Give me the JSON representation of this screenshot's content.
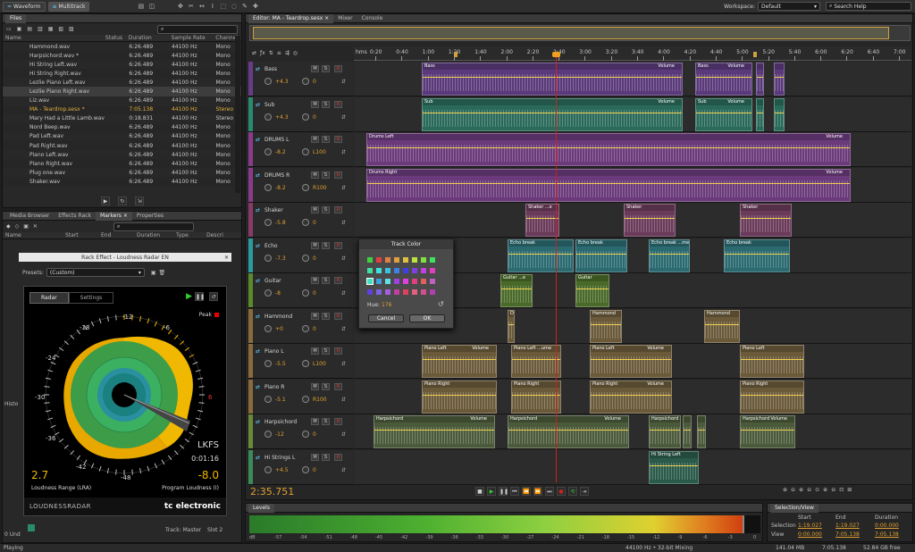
{
  "topbar": {
    "waveform": "Waveform",
    "multitrack": "Multitrack",
    "workspace_label": "Workspace:",
    "workspace_value": "Default",
    "search_placeholder": "Search Help"
  },
  "files": {
    "title": "Files",
    "columns": {
      "name": "Name",
      "status": "Status",
      "duration": "Duration",
      "sample_rate": "Sample Rate",
      "channels": "Channels"
    },
    "rows": [
      {
        "name": "Hammond.wav",
        "duration": "6:26.489",
        "sr": "44100 Hz",
        "ch": "Mono"
      },
      {
        "name": "Harpsichord.wav *",
        "duration": "6:26.489",
        "sr": "44100 Hz",
        "ch": "Mono"
      },
      {
        "name": "Hi String Left.wav",
        "duration": "6:26.489",
        "sr": "44100 Hz",
        "ch": "Mono"
      },
      {
        "name": "Hi String Right.wav",
        "duration": "6:26.489",
        "sr": "44100 Hz",
        "ch": "Mono"
      },
      {
        "name": "Lezlie Piano Left.wav",
        "duration": "6:26.489",
        "sr": "44100 Hz",
        "ch": "Mono"
      },
      {
        "name": "Lezlie Piano Right.wav",
        "duration": "6:26.489",
        "sr": "44100 Hz",
        "ch": "Mono"
      },
      {
        "name": "Liz.wav",
        "duration": "6:26.489",
        "sr": "44100 Hz",
        "ch": "Mono"
      },
      {
        "name": "MA - Teardrop.sesx *",
        "duration": "7:05.138",
        "sr": "44100 Hz",
        "ch": "Stereo"
      },
      {
        "name": "Mary Had a Little Lamb.wav",
        "duration": "0:18.831",
        "sr": "44100 Hz",
        "ch": "Stereo"
      },
      {
        "name": "Nord Beep.wav",
        "duration": "6:26.489",
        "sr": "44100 Hz",
        "ch": "Mono"
      },
      {
        "name": "Pad Left.wav",
        "duration": "6:26.489",
        "sr": "44100 Hz",
        "ch": "Mono"
      },
      {
        "name": "Pad Right.wav",
        "duration": "6:26.489",
        "sr": "44100 Hz",
        "ch": "Mono"
      },
      {
        "name": "Piano Left.wav",
        "duration": "6:26.489",
        "sr": "44100 Hz",
        "ch": "Mono"
      },
      {
        "name": "Piano Right.wav",
        "duration": "6:26.489",
        "sr": "44100 Hz",
        "ch": "Mono"
      },
      {
        "name": "Plug one.wav",
        "duration": "6:26.489",
        "sr": "44100 Hz",
        "ch": "Mono"
      },
      {
        "name": "Shaker.wav",
        "duration": "6:26.489",
        "sr": "44100 Hz",
        "ch": "Mono"
      }
    ]
  },
  "midpanel": {
    "tabs": [
      "Media Browser",
      "Effects Rack",
      "Markers ×",
      "Properties"
    ],
    "columns": [
      "Name",
      "Start",
      "End",
      "Duration",
      "Type",
      "Descri"
    ],
    "search_icon": "search-icon"
  },
  "rack": {
    "title": "Rack Effect - Loudness Radar EN",
    "presets_label": "Presets:",
    "presets_value": "(Custom)"
  },
  "radar": {
    "tab_radar": "Radar",
    "tab_settings": "Settings",
    "peak": "Peak",
    "ring_labels": [
      "-12",
      "-6",
      "-18",
      "-24",
      "-30",
      "-36",
      "-42",
      "-48",
      "6"
    ],
    "lkfs": "LKFS",
    "time": "0:01:16",
    "lra_value": "2.7",
    "lra_label": "Loudness Range (LRA)",
    "program_value": "-8.0",
    "program_label": "Program Loudness (I)",
    "brand_left": "LOUDNESSRADAR",
    "brand_right": "tc electronic",
    "track_label": "Track: Master",
    "slot_label": "Slot 2"
  },
  "history": {
    "title": "Histo",
    "und": "0 Und"
  },
  "editor": {
    "tab": "Editor: MA - Teardrop.sesx ×",
    "mixer": "Mixer",
    "console": "Console",
    "ruler_unit": "hms",
    "ruler": [
      "0:20",
      "0:40",
      "1:00",
      "1:20",
      "1:40",
      "2:00",
      "2:20",
      "2:40",
      "3:00",
      "3:20",
      "3:40",
      "4:00",
      "4:20",
      "4:40",
      "5:00",
      "5:20",
      "5:40",
      "6:00",
      "6:20",
      "6:40",
      "7:00"
    ]
  },
  "tracks": [
    {
      "name": "Bass",
      "vol": "+4.3",
      "pan": "0",
      "color": "#6a3a8a"
    },
    {
      "name": "Sub",
      "vol": "+4.3",
      "pan": "0",
      "color": "#2a8a70"
    },
    {
      "name": "DRUMS L",
      "vol": "-8.2",
      "pan": "L100",
      "color": "#8a3a8a"
    },
    {
      "name": "DRUMS R",
      "vol": "-8.2",
      "pan": "R100",
      "color": "#8a3a8a"
    },
    {
      "name": "Shaker",
      "vol": "-5.8",
      "pan": "0",
      "color": "#8a3a6a"
    },
    {
      "name": "Echo",
      "vol": "-7.3",
      "pan": "0",
      "color": "#2a9aa0"
    },
    {
      "name": "Guitar",
      "vol": "-8",
      "pan": "0",
      "color": "#5a8a2a"
    },
    {
      "name": "Hammond",
      "vol": "+0",
      "pan": "0",
      "color": "#8a6a3a"
    },
    {
      "name": "Piano L",
      "vol": "-5.5",
      "pan": "L100",
      "color": "#8a6a3a"
    },
    {
      "name": "Piano R",
      "vol": "-5.1",
      "pan": "R100",
      "color": "#8a6a3a"
    },
    {
      "name": "Harpsichord",
      "vol": "-12",
      "pan": "0",
      "color": "#6a8a3a"
    },
    {
      "name": "Hi Strings L",
      "vol": "+4.5",
      "pan": "0",
      "color": "#3a8a5a"
    }
  ],
  "clips": {
    "bass": "Bass",
    "sub": "Sub",
    "drums_left": "Drums Left",
    "drums_right": "Drums Right",
    "shaker": "Shaker ...e",
    "shaker2": "Shaker",
    "echo": "Echo break",
    "echo2": "Echo break ...me",
    "guitar": "Guitar ...e",
    "guitar2": "Guitar",
    "hammond": "Hammond",
    "piano_left": "Piano Left",
    "piano_left2": "Piano Left ...ume",
    "piano_right": "Piano Right",
    "harpsichord": "Harpsichord",
    "hi_string": "Hi String Left",
    "volume": "Volume",
    "d": "D"
  },
  "dialog": {
    "title": "Track Color",
    "hue_label": "Hue:",
    "hue_value": "176",
    "cancel": "Cancel",
    "ok": "OK"
  },
  "transport": {
    "time": "2:35.751"
  },
  "levels": {
    "title": "Levels",
    "scale": [
      "dB",
      "-57",
      "-54",
      "-51",
      "-48",
      "-45",
      "-42",
      "-39",
      "-36",
      "-33",
      "-30",
      "-27",
      "-24",
      "-21",
      "-18",
      "-15",
      "-12",
      "-9",
      "-6",
      "-3",
      "0"
    ]
  },
  "selection": {
    "title": "Selection/View",
    "start_label": "Start",
    "end_label": "End",
    "duration_label": "Duration",
    "sel_label": "Selection",
    "view_label": "View",
    "sel_start": "1:19.027",
    "sel_end": "1:19.027",
    "sel_dur": "0:00.000",
    "view_start": "0:00.000",
    "view_end": "7:05.138",
    "view_dur": "7:05.138"
  },
  "status": {
    "left": "Playing",
    "sr": "44100 Hz • 32-bit Mixing",
    "mb": "141.04 MB",
    "dur": "7:05.138",
    "free": "52.84 GB free"
  }
}
